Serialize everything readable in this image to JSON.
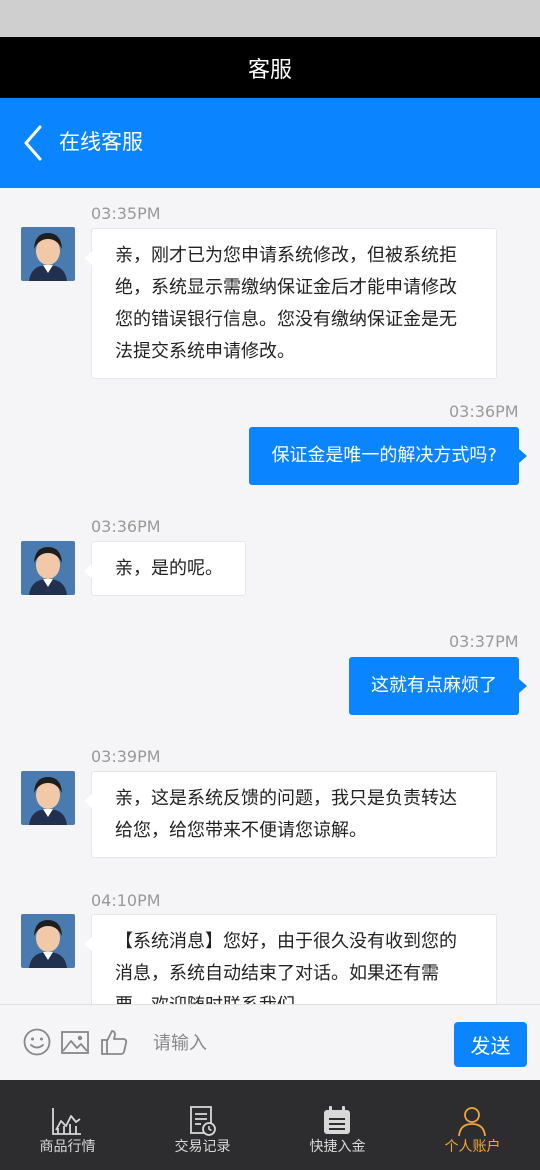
{
  "status_bar": {},
  "window": {
    "title": "客服"
  },
  "nav": {
    "title": "在线客服"
  },
  "messages": [
    {
      "time": "03:35PM",
      "from": "agent",
      "text": "亲，刚才已为您申请系统修改，但被系统拒绝，系统显示需缴纳保证金后才能申请修改您的错误银行信息。您没有缴纳保证金是无法提交系统申请修改。"
    },
    {
      "time": "03:36PM",
      "from": "user",
      "text": "保证金是唯一的解决方式吗?"
    },
    {
      "time": "03:36PM",
      "from": "agent",
      "text": "亲，是的呢。"
    },
    {
      "time": "03:37PM",
      "from": "user",
      "text": "这就有点麻烦了"
    },
    {
      "time": "03:39PM",
      "from": "agent",
      "text": "亲，这是系统反馈的问题，我只是负责转达给您，给您带来不便请您谅解。"
    },
    {
      "time": "04:10PM",
      "from": "agent",
      "text": "【系统消息】您好，由于很久没有收到您的消息，系统自动结束了对话。如果还有需要，欢迎随时联系我们。"
    }
  ],
  "input": {
    "placeholder": "请输入",
    "send_label": "发送"
  },
  "tabs": [
    {
      "label": "商品行情",
      "icon": "chart-icon"
    },
    {
      "label": "交易记录",
      "icon": "record-icon"
    },
    {
      "label": "快捷入金",
      "icon": "calendar-icon"
    },
    {
      "label": "个人账户",
      "icon": "person-icon"
    }
  ],
  "colors": {
    "accent": "#0a84ff",
    "title_bg": "#000000",
    "tab_bg": "#2d2d2f",
    "tab_active": "#f0a53c"
  }
}
